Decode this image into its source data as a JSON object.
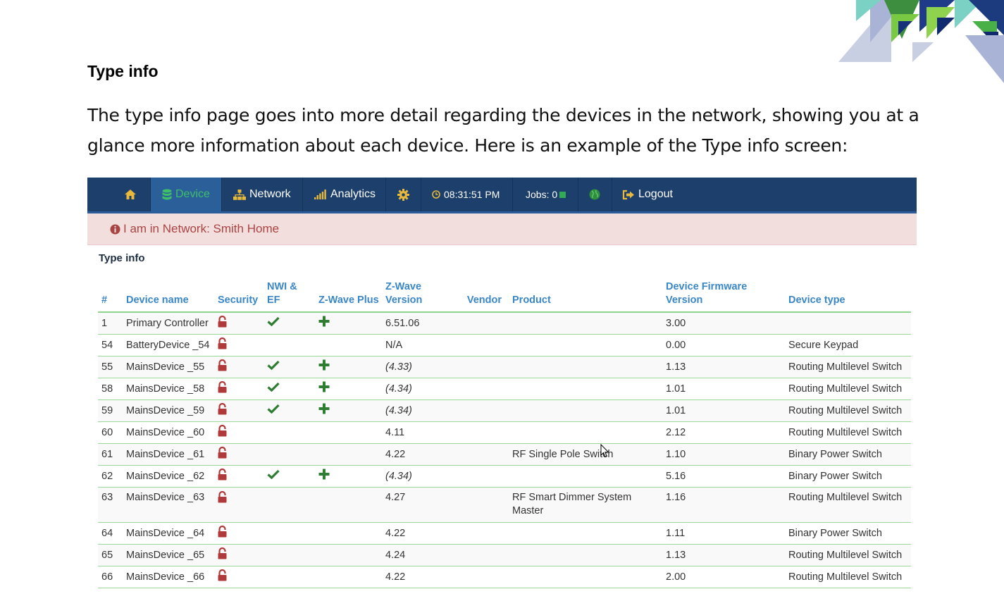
{
  "document": {
    "heading": "Type info",
    "paragraph": "The type info page goes into more detail regarding the devices in the network, showing you at a glance more information about each device.  Here is an example of the Type info screen:"
  },
  "navbar": {
    "items": [
      {
        "id": "home",
        "label": "",
        "icon": "home-icon"
      },
      {
        "id": "device",
        "label": "Device",
        "icon": "database-icon",
        "active": true
      },
      {
        "id": "network",
        "label": "Network",
        "icon": "sitemap-icon"
      },
      {
        "id": "analytics",
        "label": "Analytics",
        "icon": "signal-icon"
      },
      {
        "id": "settings",
        "label": "",
        "icon": "gear-icon"
      },
      {
        "id": "clock",
        "label": "08:31:51 PM",
        "icon": "clock-icon"
      },
      {
        "id": "jobs",
        "label": "Jobs: 0",
        "icon": "status-square-icon"
      },
      {
        "id": "globe",
        "label": "",
        "icon": "globe-icon"
      },
      {
        "id": "logout",
        "label": "Logout",
        "icon": "logout-icon"
      }
    ]
  },
  "alert": {
    "text": "I am in Network: Smith Home",
    "icon": "info-circle-icon"
  },
  "panel": {
    "title": "Type info"
  },
  "table": {
    "headers": {
      "num": "#",
      "device_name": "Device name",
      "security": "Security",
      "nwi_ef": "NWI & EF",
      "zwave_plus": "Z-Wave Plus",
      "zwave_version": "Z-Wave Version",
      "vendor": "Vendor",
      "product": "Product",
      "firmware": "Device Firmware Version",
      "device_type": "Device type"
    },
    "rows": [
      {
        "num": "1",
        "name": "Primary Controller",
        "nwi": true,
        "plus": true,
        "version": "6.51.06",
        "italic": false,
        "vendor": "",
        "product": "",
        "firmware": "3.00",
        "type": ""
      },
      {
        "num": "54",
        "name": "BatteryDevice _54",
        "nwi": false,
        "plus": false,
        "version": "N/A",
        "italic": false,
        "vendor": "",
        "product": "",
        "firmware": "0.00",
        "type": "Secure Keypad"
      },
      {
        "num": "55",
        "name": "MainsDevice _55",
        "nwi": true,
        "plus": true,
        "version": "(4.33)",
        "italic": true,
        "vendor": "",
        "product": "",
        "firmware": "1.13",
        "type": "Routing Multilevel Switch"
      },
      {
        "num": "58",
        "name": "MainsDevice _58",
        "nwi": true,
        "plus": true,
        "version": "(4.34)",
        "italic": true,
        "vendor": "",
        "product": "",
        "firmware": "1.01",
        "type": "Routing Multilevel Switch"
      },
      {
        "num": "59",
        "name": "MainsDevice _59",
        "nwi": true,
        "plus": true,
        "version": "(4.34)",
        "italic": true,
        "vendor": "",
        "product": "",
        "firmware": "1.01",
        "type": "Routing Multilevel Switch"
      },
      {
        "num": "60",
        "name": "MainsDevice _60",
        "nwi": false,
        "plus": false,
        "version": "4.11",
        "italic": false,
        "vendor": "",
        "product": "",
        "firmware": "2.12",
        "type": "Routing Multilevel Switch"
      },
      {
        "num": "61",
        "name": "MainsDevice _61",
        "nwi": false,
        "plus": false,
        "version": "4.22",
        "italic": false,
        "vendor": "",
        "product": "RF Single Pole Switch",
        "firmware": "1.10",
        "type": "Binary Power Switch"
      },
      {
        "num": "62",
        "name": "MainsDevice _62",
        "nwi": true,
        "plus": true,
        "version": "(4.34)",
        "italic": true,
        "vendor": "",
        "product": "",
        "firmware": "5.16",
        "type": "Binary Power Switch"
      },
      {
        "num": "63",
        "name": "MainsDevice _63",
        "nwi": false,
        "plus": false,
        "version": "4.27",
        "italic": false,
        "vendor": "",
        "product": "RF Smart Dimmer System Master",
        "firmware": "1.16",
        "type": "Routing Multilevel Switch"
      },
      {
        "num": "64",
        "name": "MainsDevice _64",
        "nwi": false,
        "plus": false,
        "version": "4.22",
        "italic": false,
        "vendor": "",
        "product": "",
        "firmware": "1.11",
        "type": "Binary Power Switch"
      },
      {
        "num": "65",
        "name": "MainsDevice _65",
        "nwi": false,
        "plus": false,
        "version": "4.24",
        "italic": false,
        "vendor": "",
        "product": "",
        "firmware": "1.13",
        "type": "Routing Multilevel Switch"
      },
      {
        "num": "66",
        "name": "MainsDevice _66",
        "nwi": false,
        "plus": false,
        "version": "4.22",
        "italic": false,
        "vendor": "",
        "product": "",
        "firmware": "2.00",
        "type": "Routing Multilevel Switch"
      }
    ]
  },
  "colors": {
    "navbar": "#1d3f6c",
    "active_tab": "#2b5f9a",
    "alert_bg": "#f3dede",
    "alert_text": "#a94442",
    "header_text": "#3a87c8",
    "row_border": "#98d898",
    "check_green": "#2e7d32",
    "lock_red": "#b03a3a"
  }
}
